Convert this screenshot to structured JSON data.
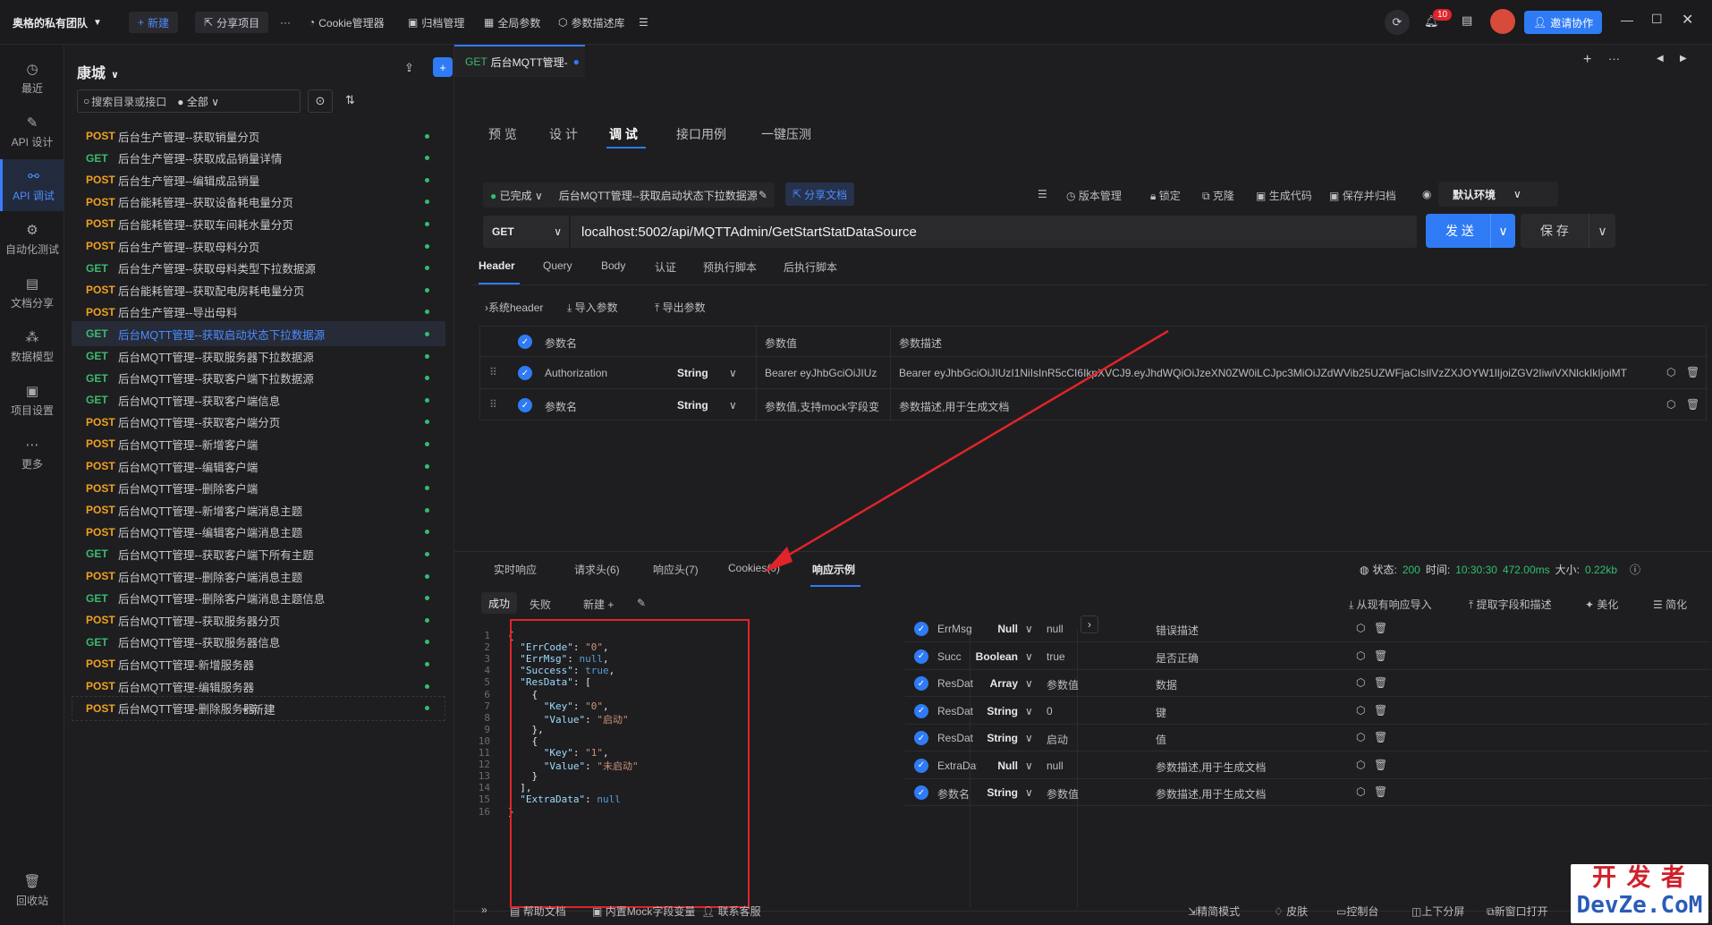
{
  "topbar": {
    "team": "奥格的私有团队",
    "new_label": "新建",
    "share_label": "分享项目",
    "more": "···",
    "cookie": "Cookie管理器",
    "archive": "归档管理",
    "global_params": "全局参数",
    "param_desc": "参数描述库",
    "notif_count": "10",
    "invite": "邀请协作"
  },
  "nav": [
    {
      "label": "最近",
      "icon": "clock-icon"
    },
    {
      "label": "API 设计",
      "icon": "edit-icon"
    },
    {
      "label": "API 调试",
      "icon": "link-icon"
    },
    {
      "label": "自动化测试",
      "icon": "flow-icon"
    },
    {
      "label": "文档分享",
      "icon": "doc-icon"
    },
    {
      "label": "数据模型",
      "icon": "model-icon"
    },
    {
      "label": "项目设置",
      "icon": "settings-icon"
    },
    {
      "label": "更多",
      "icon": "more-icon"
    },
    {
      "label": "回收站",
      "icon": "trash-icon"
    }
  ],
  "project": {
    "name": "康城",
    "search_placeholder": "搜索目录或接口",
    "filter": "全部",
    "new_label": "新建"
  },
  "api_list": [
    {
      "method": "POST",
      "name": "后台生产管理--获取销量分页"
    },
    {
      "method": "GET",
      "name": "后台生产管理--获取成品销量详情"
    },
    {
      "method": "POST",
      "name": "后台生产管理--编辑成品销量"
    },
    {
      "method": "POST",
      "name": "后台能耗管理--获取设备耗电量分页"
    },
    {
      "method": "POST",
      "name": "后台能耗管理--获取车间耗水量分页"
    },
    {
      "method": "POST",
      "name": "后台生产管理--获取母料分页"
    },
    {
      "method": "GET",
      "name": "后台生产管理--获取母料类型下拉数据源"
    },
    {
      "method": "POST",
      "name": "后台能耗管理--获取配电房耗电量分页"
    },
    {
      "method": "POST",
      "name": "后台生产管理--导出母料"
    },
    {
      "method": "GET",
      "name": "后台MQTT管理--获取启动状态下拉数据源"
    },
    {
      "method": "GET",
      "name": "后台MQTT管理--获取服务器下拉数据源"
    },
    {
      "method": "GET",
      "name": "后台MQTT管理--获取客户端下拉数据源"
    },
    {
      "method": "GET",
      "name": "后台MQTT管理--获取客户端信息"
    },
    {
      "method": "POST",
      "name": "后台MQTT管理--获取客户端分页"
    },
    {
      "method": "POST",
      "name": "后台MQTT管理--新增客户端"
    },
    {
      "method": "POST",
      "name": "后台MQTT管理--编辑客户端"
    },
    {
      "method": "POST",
      "name": "后台MQTT管理--删除客户端"
    },
    {
      "method": "POST",
      "name": "后台MQTT管理--新增客户端消息主题"
    },
    {
      "method": "POST",
      "name": "后台MQTT管理--编辑客户端消息主题"
    },
    {
      "method": "GET",
      "name": "后台MQTT管理--获取客户端下所有主题"
    },
    {
      "method": "POST",
      "name": "后台MQTT管理--删除客户端消息主题"
    },
    {
      "method": "GET",
      "name": "后台MQTT管理--删除客户端消息主题信息"
    },
    {
      "method": "POST",
      "name": "后台MQTT管理--获取服务器分页"
    },
    {
      "method": "GET",
      "name": "后台MQTT管理--获取服务器信息"
    },
    {
      "method": "POST",
      "name": "后台MQTT管理-新增服务器"
    },
    {
      "method": "POST",
      "name": "后台MQTT管理-编辑服务器"
    },
    {
      "method": "POST",
      "name": "后台MQTT管理-删除服务器"
    }
  ],
  "doc_tab": {
    "method": "GET",
    "title": "后台MQTT管理-"
  },
  "view_tabs": [
    "预 览",
    "设 计",
    "调 试",
    "接口用例",
    "一键压测"
  ],
  "status": {
    "state": "已完成",
    "api_name": "后台MQTT管理--获取启动状态下拉数据源",
    "share": "分享文档",
    "version": "版本管理",
    "lock": "锁定",
    "clone": "克隆",
    "gen_code": "生成代码",
    "save_archive": "保存并归档",
    "env": "默认环境"
  },
  "request": {
    "method": "GET",
    "url": "localhost:5002/api/MQTTAdmin/GetStartStatDataSource",
    "send": "发 送",
    "save": "保 存"
  },
  "req_tabs": [
    "Header",
    "Query",
    "Body",
    "认证",
    "预执行脚本",
    "后执行脚本"
  ],
  "header_tools": {
    "system": "系统header",
    "import": "导入参数",
    "export": "导出参数"
  },
  "header_table": {
    "cols": [
      "参数名",
      "参数值",
      "参数描述"
    ],
    "rows": [
      {
        "name": "Authorization",
        "type": "String",
        "value": "Bearer eyJhbGciOiJIUz",
        "desc": "Bearer eyJhbGciOiJIUzI1NiIsInR5cCI6IkpXVCJ9.eyJhdWQiOiJzeXN0ZW0iLCJpc3MiOiJZdWVib25UZWFjaCIsIlVzZXJOYW1lIjoiZGV2IiwiVXNlckIkIjoiMT"
      },
      {
        "name": "参数名",
        "type": "String",
        "value": "参数值,支持mock字段变",
        "desc": "参数描述,用于生成文档"
      }
    ]
  },
  "resp_tabs": [
    "实时响应",
    "请求头(6)",
    "响应头(7)",
    "Cookies(0)",
    "响应示例"
  ],
  "resp_status": {
    "state_label": "状态:",
    "code": "200",
    "time_label": "时间:",
    "time": "10:30:30",
    "duration": "472.00ms",
    "size_label": "大小:",
    "size": "0.22kb"
  },
  "example_tabs": {
    "success": "成功",
    "fail": "失败",
    "new": "新建"
  },
  "example_tools": {
    "import": "从现有响应导入",
    "extract": "提取字段和描述",
    "beautify": "美化",
    "simplify": "简化"
  },
  "json_lines": [
    "{",
    "  \"ErrCode\": \"0\",",
    "  \"ErrMsg\": null,",
    "  \"Success\": true,",
    "  \"ResData\": [",
    "    {",
    "      \"Key\": \"0\",",
    "      \"Value\": \"启动\"",
    "    },",
    "    {",
    "      \"Key\": \"1\",",
    "      \"Value\": \"未启动\"",
    "    }",
    "  ],",
    "  \"ExtraData\": null",
    "}"
  ],
  "fields": [
    {
      "name": "ErrMsg",
      "type": "Null",
      "value": "null",
      "desc": "错误描述"
    },
    {
      "name": "Succ",
      "type": "Boolean",
      "value": "true",
      "desc": "是否正确"
    },
    {
      "name": "ResDat",
      "type": "Array",
      "value": "参数值",
      "desc": "数据"
    },
    {
      "name": "ResDat",
      "type": "String",
      "value": "0",
      "desc": "键"
    },
    {
      "name": "ResDat",
      "type": "String",
      "value": "启动",
      "desc": "值"
    },
    {
      "name": "ExtraDat",
      "type": "Null",
      "value": "null",
      "desc": "参数描述,用于生成文档"
    },
    {
      "name": "参数名",
      "type": "String",
      "value": "参数值",
      "desc": "参数描述,用于生成文档"
    }
  ],
  "footer": {
    "help": "帮助文档",
    "mock": "内置Mock字段变量",
    "support": "联系客服",
    "simple": "精简模式",
    "skin": "皮肤",
    "console": "控制台",
    "split": "上下分屏",
    "new_window": "新窗口打开"
  },
  "watermark": {
    "line1": "开 发 者",
    "line2": "DevZe.CoM"
  },
  "colors": {
    "accent": "#2f7bf5",
    "post": "#f0a020",
    "get": "#3cba6d",
    "annotation": "#e0242a"
  }
}
